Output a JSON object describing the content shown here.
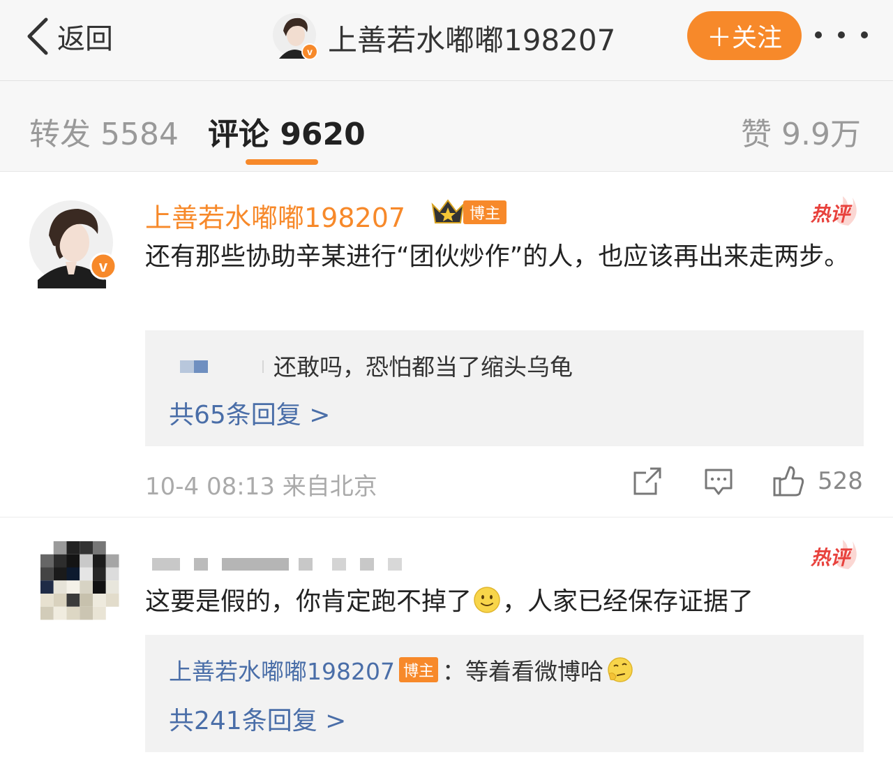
{
  "header": {
    "back_label": "返回",
    "title": "上善若水嘟嘟198207",
    "follow_label": "＋关注"
  },
  "tabs": {
    "repost": "转发 5584",
    "comment": "评论 9620",
    "like": "赞 9.9万"
  },
  "colors": {
    "accent": "#f7892a",
    "link": "#4a6ea8",
    "hot": "#e8423d"
  },
  "comments": [
    {
      "username": "上善若水嘟嘟198207",
      "badge": "博主",
      "hot_tag": "热评",
      "text": "还有那些协助辛某进行“团伙炒作”的人，也应该再出来走两步。",
      "reply_preview": "还敢吗，恐怕都当了缩头乌龟",
      "reply_more": "共65条回复 >",
      "meta": "10-4 08:13 来自北京",
      "likes": "528",
      "icons": [
        "share-icon",
        "comment-icon",
        "like-icon"
      ]
    },
    {
      "hot_tag": "热评",
      "text_before": "这要是假的，你肯定跑不掉了",
      "text_after": "，人家已经保存证据了",
      "reply_user": "上善若水嘟嘟198207",
      "reply_badge": "博主",
      "reply_text": "：等着看微博哈",
      "reply_more": "共241条回复 >"
    }
  ]
}
